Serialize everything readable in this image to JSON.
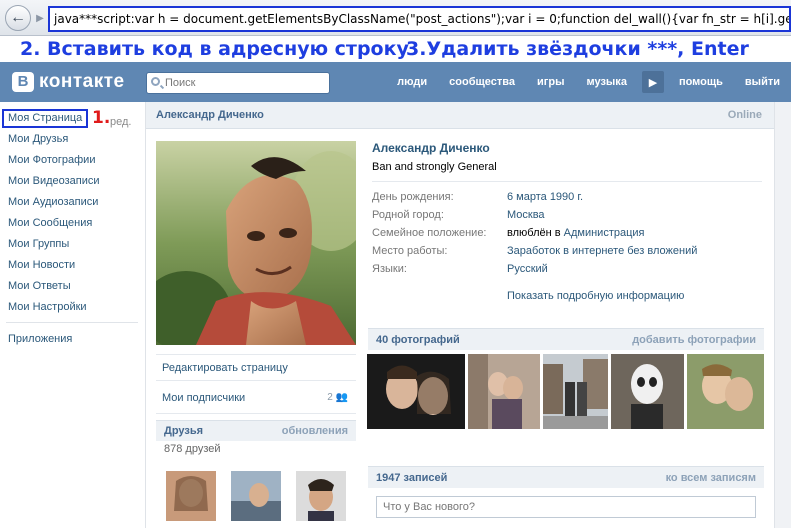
{
  "browser": {
    "address": "java***script:var h = document.getElementsByClassName(\"post_actions\");var i = 0;function del_wall(){var fn_str = h[i].getElementsByTagNam"
  },
  "instructions": {
    "step2": "2. Вставить код в адресную строку",
    "step3": "3.Удалить звёздочки ***, Enter",
    "step1_marker": "1.",
    "edit_suffix": "ред."
  },
  "header": {
    "logo_letter": "В",
    "logo_text": "контакте",
    "search_placeholder": "Поиск",
    "nav": [
      "люди",
      "сообщества",
      "игры",
      "музыка",
      "помощь",
      "выйти"
    ]
  },
  "left_menu": {
    "items": [
      "Моя Страница",
      "Мои Друзья",
      "Мои Фотографии",
      "Мои Видеозаписи",
      "Мои Аудиозаписи",
      "Мои Сообщения",
      "Мои Группы",
      "Мои Новости",
      "Мои Ответы",
      "Мои Настройки"
    ],
    "apps": "Приложения"
  },
  "profile": {
    "header_name": "Александр Диченко",
    "online": "Online",
    "full_name": "Александр Диченко",
    "status": "Ban and strongly General",
    "info": [
      {
        "label": "День рождения:",
        "value": "6 марта 1990 г."
      },
      {
        "label": "Родной город:",
        "value": "Москва"
      },
      {
        "label": "Семейное положение:",
        "value_plain": "влюблён в ",
        "value": "Администрация"
      },
      {
        "label": "Место работы:",
        "value": "Заработок в интернете без вложений"
      },
      {
        "label": "Языки:",
        "value": "Русский"
      }
    ],
    "more_info": "Показать подробную информацию",
    "edit_page": "Редактировать страницу",
    "subscribers": "Мои подписчики",
    "subscribers_count": "2",
    "friends_title": "Друзья",
    "friends_updates": "обновления",
    "friends_count": "878 друзей",
    "photos_title": "40 фотографий",
    "add_photos": "добавить фотографии",
    "wall_title": "1947 записей",
    "wall_all": "ко всем записям",
    "wall_placeholder": "Что у Вас нового?"
  },
  "colors": {
    "vk_blue": "#5f87b3",
    "link": "#2b587a",
    "instruction_blue": "#1e3ee0",
    "marker_red": "#e01b1b"
  }
}
